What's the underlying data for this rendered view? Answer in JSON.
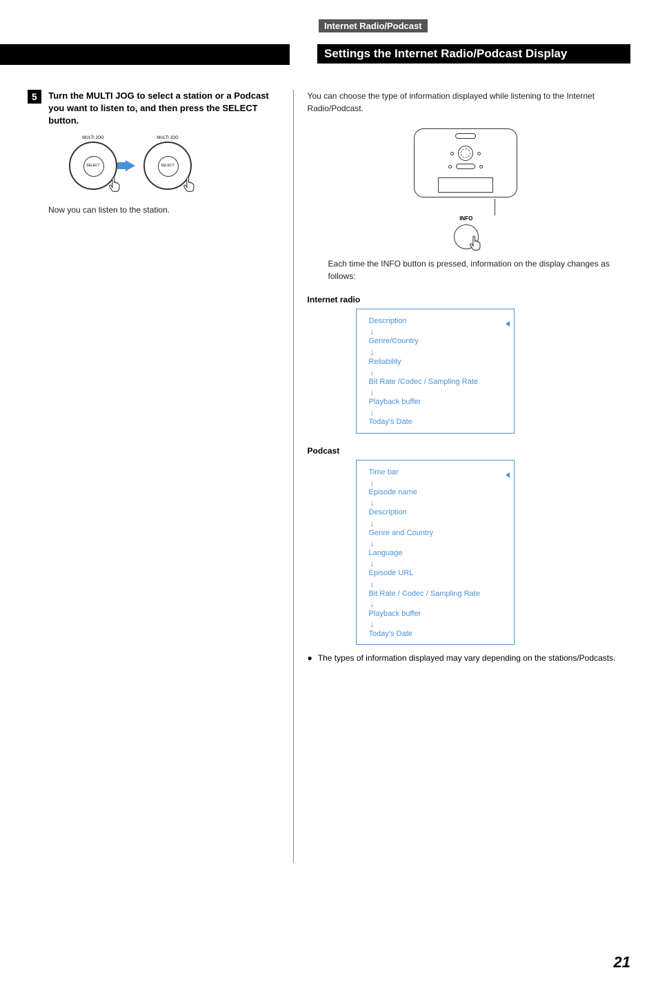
{
  "section_label": "Internet Radio/Podcast",
  "heading": "Settings the Internet Radio/Podcast Display",
  "step_number": "5",
  "step_text": "Turn the MULTI JOG to select a station or a Podcast you want to listen to, and then press the SELECT button.",
  "jog_label": "MULTI JOG",
  "jog_select": "SELECT",
  "after_step_text": "Now you can listen to the station.",
  "intro_text": "You can choose the type of information displayed while listening to the Internet Radio/Podcast.",
  "info_label": "INFO",
  "info_text": "Each time the INFO button is pressed, information on the display changes as follows:",
  "internet_radio_heading": "Internet radio",
  "internet_radio_flow": [
    "Description",
    "Genre/Country",
    "Reliability",
    "Bit Rate /Codec / Sampling Rate",
    "Playback buffer",
    "Today's Date"
  ],
  "podcast_heading": "Podcast",
  "podcast_flow": [
    "Time bar",
    "Episode name",
    "Description",
    "Genre and Country",
    "Language",
    "Episode URL",
    "Bit Rate / Codec / Sampling Rate",
    "Playback buffer",
    "Today's Date"
  ],
  "bullet_text": "The types of information displayed may vary depending on the stations/Podcasts.",
  "page_number": "21"
}
